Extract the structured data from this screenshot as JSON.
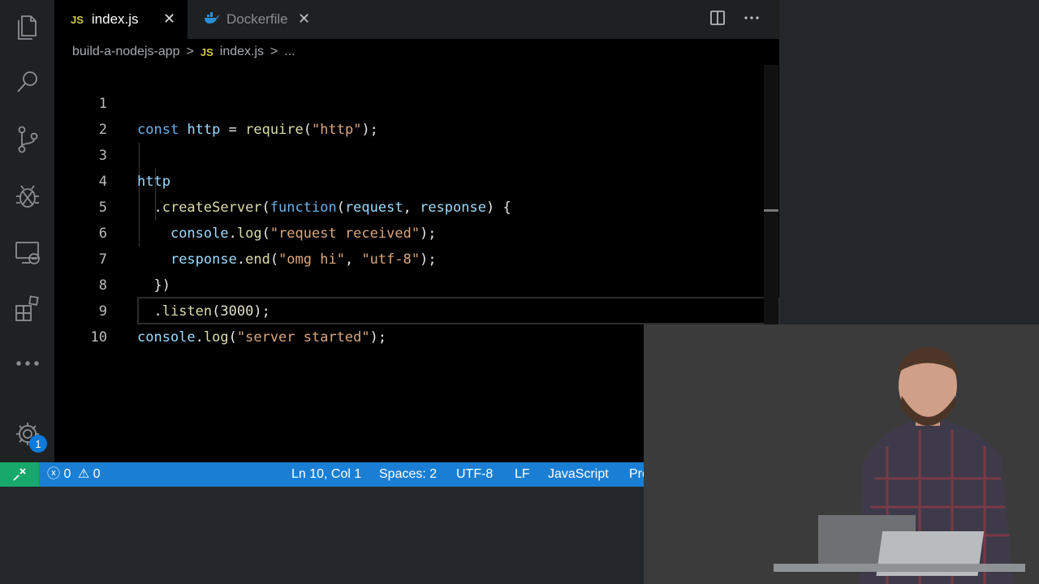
{
  "tabs": [
    {
      "icon": "JS",
      "label": "index.js"
    },
    {
      "label": "Dockerfile"
    }
  ],
  "breadcrumbs": {
    "folder": "build-a-nodejs-app",
    "file_icon": "JS",
    "file": "index.js",
    "ellipsis": "..."
  },
  "editor": {
    "line_numbers": [
      "1",
      "2",
      "3",
      "4",
      "5",
      "6",
      "7",
      "8",
      "9",
      "10"
    ],
    "lines": [
      "const http = require(\"http\");",
      "",
      "http",
      "  .createServer(function(request, response) {",
      "    console.log(\"request received\");",
      "    response.end(\"omg hi\", \"utf-8\");",
      "  })",
      "  .listen(3000);",
      "console.log(\"server started\");",
      ""
    ]
  },
  "activity_bar": {
    "settings_badge": "1"
  },
  "status_bar": {
    "errors": "0",
    "warnings": "0",
    "cursor": "Ln 10, Col 1",
    "spaces": "Spaces: 2",
    "encoding": "UTF-8",
    "eol": "LF",
    "language": "JavaScript",
    "formatter": "Prettier: ✓"
  },
  "colors": {
    "status_bar": "#1a7fd4",
    "remote": "#17a86b",
    "js_badge": "#d6c94a"
  }
}
